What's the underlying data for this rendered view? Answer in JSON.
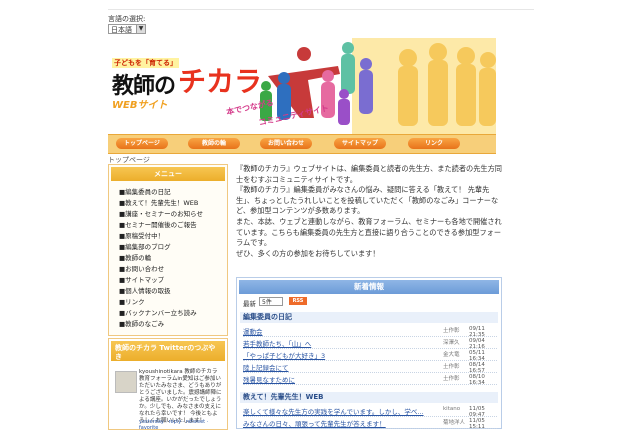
{
  "language": {
    "label": "言語の選択:",
    "selected": "日本語"
  },
  "banner": {
    "catch_small": "子どもを「育てる」",
    "title_main": "教師の",
    "title_accent": "チカラ",
    "web_site": "WEBサイト",
    "tagline_1": "本でつながる",
    "tagline_2": "コミュニティサイト"
  },
  "nav": [
    "トップページ",
    "教師の輪",
    "お問い合わせ",
    "サイトマップ",
    "リンク"
  ],
  "breadcrumb": "トップページ",
  "sidebar": {
    "menu_title": "メニュー",
    "items": [
      "■編集委員の日記",
      "■教えて！先輩先生！WEB",
      "■講座・セミナーのお知らせ",
      "■セミナー開催後のご報告",
      "■原稿受付中！",
      "■編集部のブログ",
      "■教師の輪",
      "■お問い合わせ",
      "■サイトマップ",
      "■個人情報の取扱",
      "■リンク",
      "■バックナンバー立ち読み",
      "■教師のなごみ"
    ],
    "twitter_title": "教師のチカラ Twitterのつぶやき",
    "tweet_text": "kyoushinotikara 教師のチカラ 教育フォーラムin愛知はご参加いただいたみなさま、どうもありがとうございました。震撼講師陣による講座。いかがだったでしょうか。少しでも、みなさまの支えになれたら幸いです！ 今後ともよろしくお願いいたします！",
    "tweet_links": "yesterday · reply · retweet · favorite"
  },
  "intro": [
    "『教師のチカラ』ウェブサイトは、編集委員と読者の先生方、また読者の先生方同士をむすぶコミュニティサイトです。",
    "『教師のチカラ』編集委員がみなさんの悩み、疑問に答える「教えて！ 先輩先生」、ちょっとしたうれしいことを投稿していただく「教師のなごみ」コーナーなど、参加型コンテンツが多数あります。",
    "また、本誌、ウェブと連動しながら、教育フォーラム、セミナーも各地で開催されています。こちらも編集委員の先生方と直接に語り合うことのできる参加型フォーラムです。",
    "ぜひ、多くの方の参加をお待ちしています！"
  ],
  "news": {
    "title": "新着情報",
    "per_label": "最新",
    "per_value": "5件",
    "rss_label": "RSS",
    "sections": [
      {
        "title": "編集委員の日記",
        "rows": [
          {
            "title": "運動会",
            "author": "土作彰",
            "date": "09/11 21:35"
          },
          {
            "title": "若手教師たち、「山」へ",
            "author": "深澤久",
            "date": "09/04 21:16"
          },
          {
            "title": "「やっぱ子どもが大好き」3",
            "author": "金大竜",
            "date": "05/11 16:34"
          },
          {
            "title": "陸上記録会にて",
            "author": "土作彰",
            "date": "08/14 16:57"
          },
          {
            "title": "残暑見なすために",
            "author": "土作彰",
            "date": "08/10 16:34"
          }
        ]
      },
      {
        "title": "教えて！先輩先生！WEB",
        "rows": [
          {
            "title": "楽しくて様々な先生方の実践を学んでいます。しかし、学べ...",
            "author": "kitano",
            "date": "11/05 09:47"
          },
          {
            "title": "みなさんの日々、頑張って先輩先生が答えます！",
            "author": "菊地洋人",
            "date": "11/05 15:11"
          }
        ]
      }
    ]
  },
  "colors": {
    "accent_orange": "#e8731a",
    "nav_bg": "#f7cf7a",
    "news_blue": "#6c9bd8",
    "logo_red": "#e8321e"
  }
}
